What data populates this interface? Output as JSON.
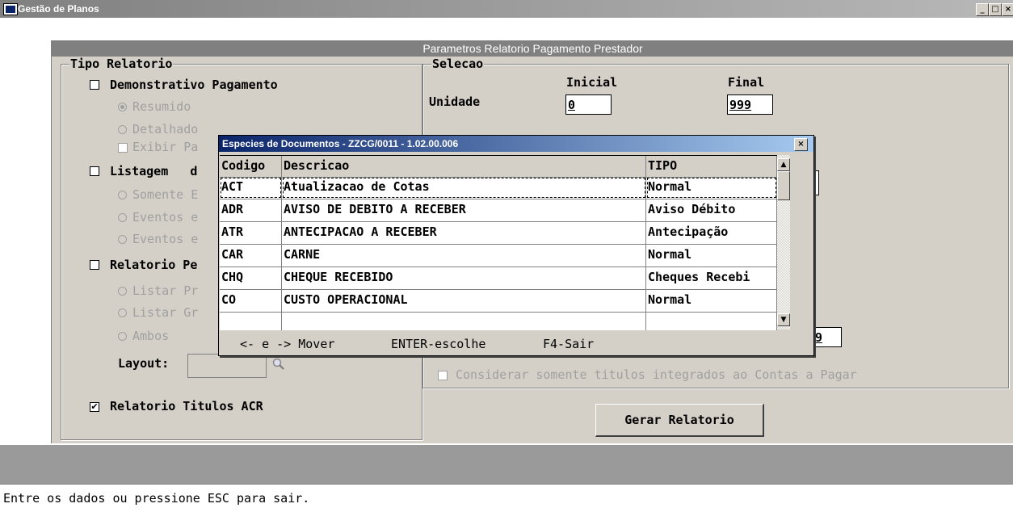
{
  "window": {
    "title": "Gestão de Planos",
    "buttons": {
      "minimize": "_",
      "maximize": "□",
      "close": "×"
    }
  },
  "panel": {
    "title": "Parametros Relatorio Pagamento Prestador"
  },
  "tipo_relatorio": {
    "legend": "Tipo Relatorio",
    "demonstrativo": {
      "label": "Demonstrativo Pagamento",
      "checked": false
    },
    "resumido": {
      "label": "Resumido",
      "selected": true
    },
    "detalhado": {
      "label": "Detalhado"
    },
    "exibir": {
      "label": "Exibir Pa"
    },
    "listagem": {
      "label": "Listagem   d"
    },
    "somente": {
      "label": "Somente E"
    },
    "eventos1": {
      "label": "Eventos e"
    },
    "eventos2": {
      "label": "Eventos e"
    },
    "relatorio_pe": {
      "label": "Relatorio Pe"
    },
    "listar_pr": {
      "label": "Listar Pr"
    },
    "listar_gr": {
      "label": "Listar Gr"
    },
    "ambos": {
      "label": "Ambos"
    },
    "layout_label": "Layout:",
    "titulos_acr": {
      "label": "Relatorio Titulos ACR",
      "checked": true,
      "mark": "✔"
    }
  },
  "selecao": {
    "legend": "Selecao",
    "col_inicial": "Inicial",
    "col_final": "Final",
    "unidade_label": "Unidade",
    "unidade_inicial": "0",
    "unidade_final": "999",
    "partial_field_value": "9",
    "considerar_label": "Considerar somente titulos integrados ao Contas a Pagar"
  },
  "gerar_button": "Gerar Relatorio",
  "popup": {
    "title": "Especies de Documentos - ZZCG/0011 - 1.02.00.006",
    "close": "×",
    "columns": [
      "Codigo",
      "Descricao",
      "TIPO"
    ],
    "rows": [
      [
        "ACT",
        "Atualizacao de Cotas",
        "Normal"
      ],
      [
        "ADR",
        "AVISO DE DEBITO A RECEBER",
        "Aviso Débito"
      ],
      [
        "ATR",
        "ANTECIPACAO A RECEBER",
        "Antecipação"
      ],
      [
        "CAR",
        "CARNE",
        "Normal"
      ],
      [
        "CHQ",
        "CHEQUE RECEBIDO",
        "Cheques Recebi"
      ],
      [
        "CO",
        "CUSTO OPERACIONAL",
        "Normal"
      ],
      [
        "",
        "",
        ""
      ]
    ],
    "footer_move": "<- e -> Mover",
    "footer_enter": "ENTER-escolhe",
    "footer_exit": "F4-Sair",
    "scroll_up": "▲",
    "scroll_down": "▼"
  },
  "status_text": "Entre os dados ou pressione ESC para sair.",
  "colors": {
    "title_gradient_start": "#0a246a",
    "title_gradient_end": "#a6caf0",
    "panel_bg": "#d4d0c8",
    "disabled_text": "#a0a0a0"
  },
  "icons": {
    "app": "app-window-icon",
    "search": "magnifier-icon"
  }
}
